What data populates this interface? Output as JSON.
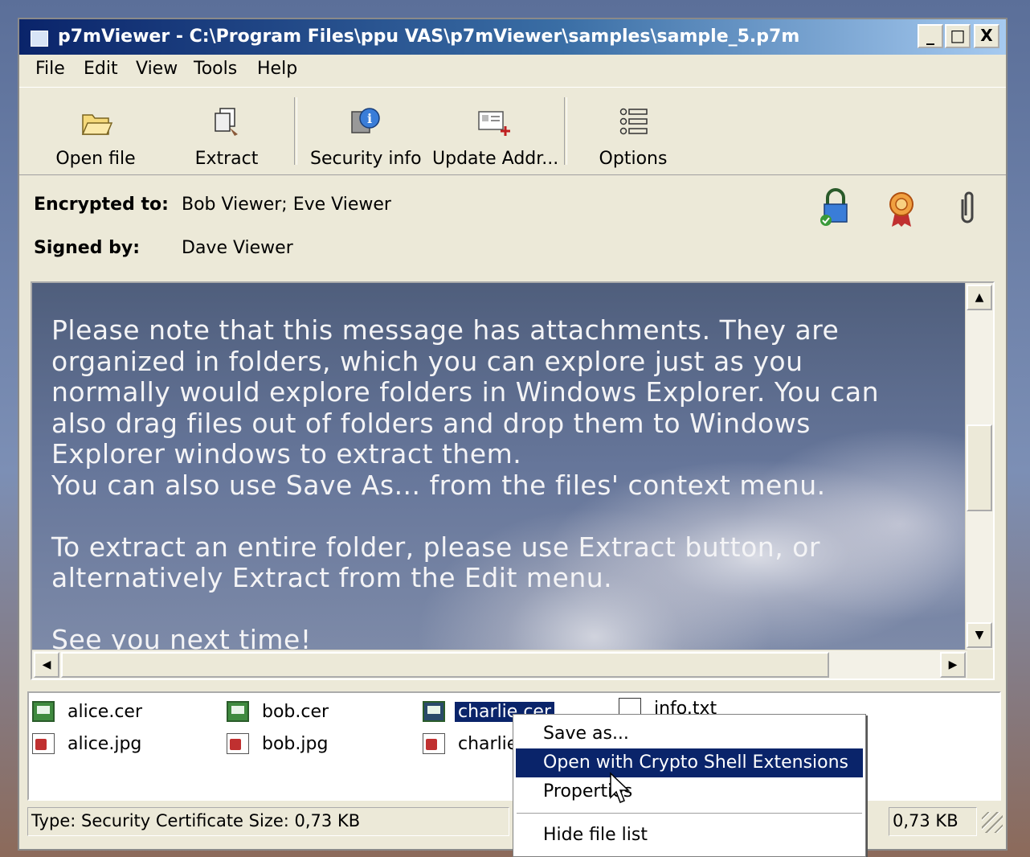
{
  "window": {
    "title": "p7mViewer - C:\\Program Files\\ppu VAS\\p7mViewer\\samples\\sample_5.p7m",
    "controls": {
      "minimize": "_",
      "maximize": "□",
      "close": "X"
    }
  },
  "menu": [
    "File",
    "Edit",
    "View",
    "Tools",
    "Help"
  ],
  "toolbar": {
    "open_file": "Open file",
    "extract": "Extract",
    "security_info": "Security info",
    "update_addr": "Update Addr...",
    "options": "Options"
  },
  "header": {
    "encrypted_label": "Encrypted to:",
    "encrypted_value": "Bob Viewer; Eve Viewer",
    "signed_label": "Signed by:",
    "signed_value": "Dave Viewer",
    "icons": [
      "lock-icon",
      "certificate-ribbon-icon",
      "paperclip-icon"
    ]
  },
  "message": {
    "body": "Please note that this message has attachments. They are\norganized in folders, which you can explore just as you\nnormally would explore folders in Windows Explorer. You can\nalso drag files out of folders and drop them to Windows\nExplorer windows to extract them.\nYou can also use Save As... from the files' context menu.\n\nTo extract an entire folder, please use Extract button, or\nalternatively Extract from the Edit menu.\n\nSee you next time!"
  },
  "files": [
    {
      "name": "alice.cer",
      "icon": "certificate-icon"
    },
    {
      "name": "alice.jpg",
      "icon": "image-icon"
    },
    {
      "name": "bob.cer",
      "icon": "certificate-icon"
    },
    {
      "name": "bob.jpg",
      "icon": "image-icon"
    },
    {
      "name": "charlie.cer",
      "icon": "certificate-icon",
      "selected": true
    },
    {
      "name": "charlie",
      "icon": "image-icon"
    },
    {
      "name": "info.txt",
      "icon": "text-file-icon"
    }
  ],
  "context_menu": {
    "items": [
      "Save as...",
      "Open with Crypto Shell Extensions",
      "Properties",
      "Hide file list"
    ],
    "highlighted": "Open with Crypto Shell Extensions"
  },
  "statusbar": {
    "left": "Type: Security Certificate  Size: 0,73 KB",
    "right": "0,73 KB"
  },
  "colors": {
    "title_start": "#0a246a",
    "title_end": "#a6caf0",
    "selection": "#0a246a",
    "window_bg": "#ece9d8"
  }
}
